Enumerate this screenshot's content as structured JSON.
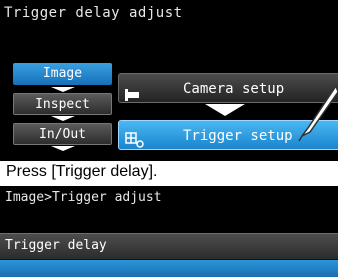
{
  "top_screen": {
    "title": "Trigger delay adjust",
    "side_menu": [
      {
        "label": "Image",
        "selected": true
      },
      {
        "label": "Inspect",
        "selected": false
      },
      {
        "label": "In/Out",
        "selected": false
      }
    ],
    "menu_items": [
      {
        "label": "Camera setup",
        "icon": "camera-bracket-icon"
      },
      {
        "label": "Trigger setup",
        "icon": "trigger-gear-icon",
        "highlighted": true
      }
    ]
  },
  "caption": "Press [Trigger delay].",
  "bottom_screen": {
    "breadcrumb": "Image>Trigger adjust",
    "row_label": "Trigger delay"
  },
  "colors": {
    "selected_blue": "#1a84cc",
    "screen_bg": "#000000"
  }
}
